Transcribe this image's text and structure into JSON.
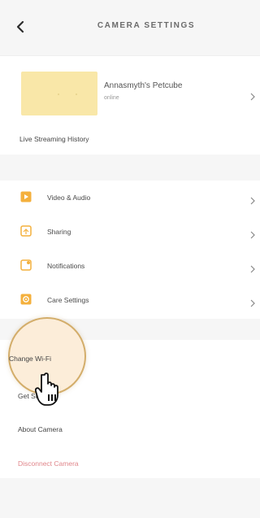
{
  "header": {
    "title": "CAMERA SETTINGS"
  },
  "camera": {
    "name": "Annasmyth's Petcube",
    "status": "online"
  },
  "history": {
    "label": "Live Streaming History"
  },
  "settings": {
    "items": [
      {
        "label": "Video & Audio",
        "icon": "video-audio-icon"
      },
      {
        "label": "Sharing",
        "icon": "sharing-icon"
      },
      {
        "label": "Notifications",
        "icon": "notifications-icon"
      },
      {
        "label": "Care Settings",
        "icon": "care-settings-icon"
      }
    ]
  },
  "actions": {
    "change_wifi": "Change Wi-Fi",
    "get_support": "Get Support",
    "about_camera": "About Camera",
    "disconnect_camera": "Disconnect Camera"
  },
  "colors": {
    "accent": "#f4b03d",
    "danger": "#e0868b",
    "highlight_ring": "#d3ad6a",
    "thumbnail": "#f9e7a8"
  }
}
